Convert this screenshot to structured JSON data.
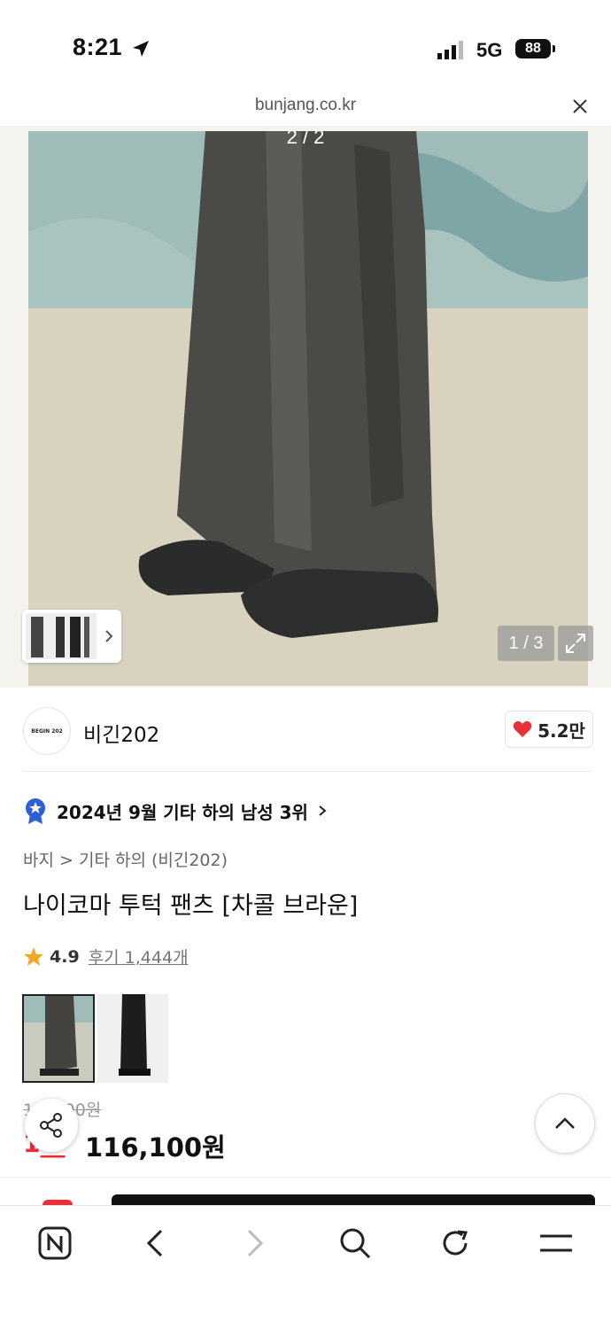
{
  "status_bar": {
    "time": "8:21",
    "network": "5G",
    "battery": "88"
  },
  "browser": {
    "url": "bunjang.co.kr"
  },
  "gallery": {
    "image_counter": "2 / 2",
    "page_indicator": "1 / 3"
  },
  "store": {
    "logo_text": "BEGIN 202",
    "name": "비긴202",
    "likes": "5.2만"
  },
  "product": {
    "rank": "2024년 9월 기타 하의 남성 3위",
    "category": "바지 > 기타 하의 (비긴202)",
    "title": "나이코마 투턱 팬츠 [차콜 브라운]",
    "rating": "4.9",
    "reviews": "후기 1,444개",
    "original_price": "1__,_00원",
    "discount": "1__",
    "price": "116,100원"
  },
  "colors": {
    "accent": "#e8303b",
    "star": "#f5a623",
    "rank_badge": "#2f5fd6"
  }
}
